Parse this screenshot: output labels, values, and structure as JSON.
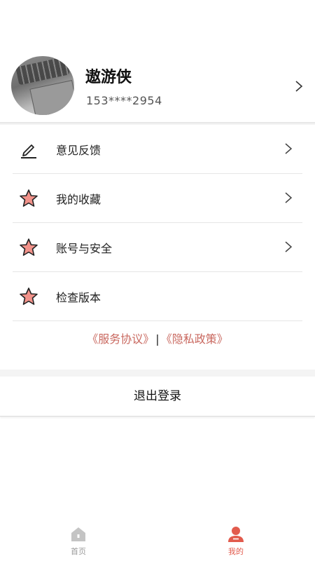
{
  "profile": {
    "username": "遨游侠",
    "phone": "153****2954"
  },
  "menu": {
    "items": [
      {
        "label": "意见反馈",
        "icon": "edit-pen-icon",
        "has_chevron": true
      },
      {
        "label": "我的收藏",
        "icon": "star-icon",
        "has_chevron": true
      },
      {
        "label": "账号与安全",
        "icon": "star-icon",
        "has_chevron": true
      },
      {
        "label": "检查版本",
        "icon": "star-icon",
        "has_chevron": false
      }
    ]
  },
  "links": {
    "service": "《服务协议》",
    "divider": "|",
    "privacy": "《隐私政策》"
  },
  "logout_label": "退出登录",
  "tabbar": {
    "home_label": "首页",
    "mine_label": "我的"
  },
  "colors": {
    "accent": "#e25b4d",
    "link": "#c9685f",
    "star_fill": "#f2928a",
    "inactive": "#9a9a9a"
  }
}
